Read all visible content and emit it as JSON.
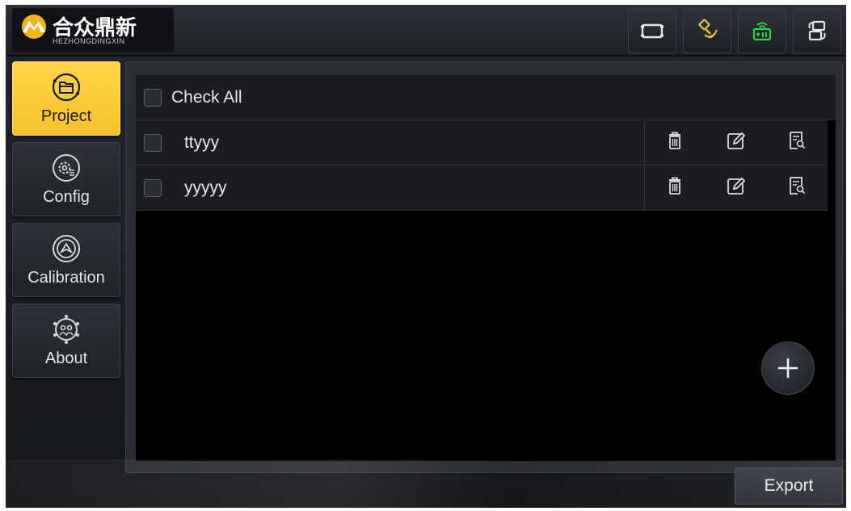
{
  "logo": {
    "cn_text": "合众鼎新",
    "sub_text": "HEZHONGDINGXIN"
  },
  "topbar": {
    "icons": [
      "screen-frame-icon",
      "satellite-icon",
      "radio-signal-icon",
      "device-switch-icon"
    ],
    "colors": {
      "satellite": "#e8c23a",
      "radio": "#2fd24a",
      "default": "#e6e6e6"
    }
  },
  "sidebar": {
    "items": [
      {
        "label": "Project",
        "icon": "folder-icon",
        "active": true
      },
      {
        "label": "Config",
        "icon": "gear-icon",
        "active": false
      },
      {
        "label": "Calibration",
        "icon": "calibration-icon",
        "active": false
      },
      {
        "label": "About",
        "icon": "about-icon",
        "active": false
      }
    ]
  },
  "project_list": {
    "check_all_label": "Check All",
    "rows": [
      {
        "name": "ttyyy"
      },
      {
        "name": "yyyyy"
      }
    ]
  },
  "actions": {
    "export_label": "Export"
  },
  "colors": {
    "accent": "#f5c12a",
    "panel": "#2a2e33",
    "list_bg": "#000000"
  }
}
